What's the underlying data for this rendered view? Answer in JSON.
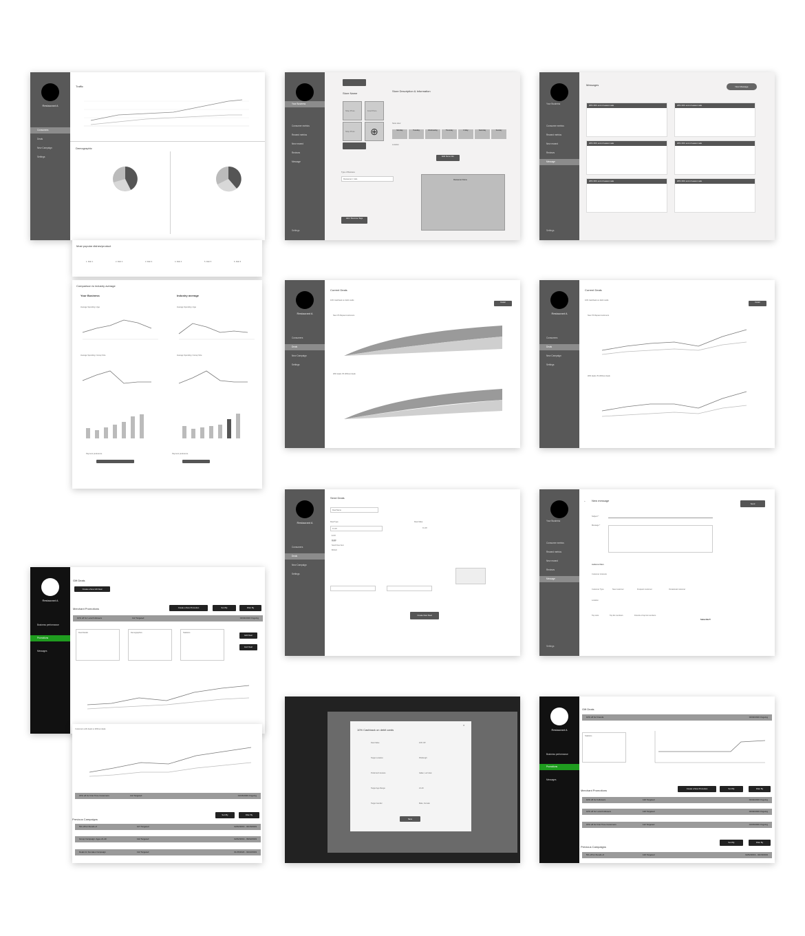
{
  "restaurant": "Restaurant A",
  "nav": {
    "your_business": "Your Business",
    "consumer_metrics": "Consumer metrics",
    "reward_metrics": "Reward metrics",
    "new_reward": "New reward",
    "reviews": "Reviews",
    "message": "Message",
    "settings": "Settings",
    "business_performance": "Business performance",
    "promotions": "Promotions",
    "messages": "Messages",
    "consumers": "Consumers",
    "deals": "Deals",
    "new_campaign": "New Campaign"
  },
  "dash": {
    "traffic": "Traffic",
    "demographic": "Demographic",
    "most_popular": "Most popular dishes/product",
    "comparison": "Comparison to industry average",
    "your_business": "Your Business",
    "industry_average": "Industry average",
    "dishes": [
      "1. Dish 1",
      "2. Dish 2",
      "3. Dish 3",
      "4. Dish 4",
      "5. Dish 5",
      "6. Dish 6"
    ],
    "payment": "Payment preference",
    "avg_spending_age": "Average Spending / Age",
    "avg_spending_group": "Average Spending / Group Size"
  },
  "store": {
    "store_name": "Store Name",
    "desc": "Store Description & Information",
    "shop_photo": "Shop Photo",
    "food_photo": "Food Photo",
    "store_hour": "Store Hour",
    "location": "Location",
    "days": [
      "Monday",
      "Tuesday",
      "Wednesday",
      "Thursday",
      "Friday",
      "Saturday",
      "Sunday"
    ],
    "edit_store_info": "Edit Store Info",
    "restaurant_menu": "Restaurant Menu",
    "add_remove_tags": "Add / Remove Tags",
    "type": "Type of Business",
    "options": [
      "Restaurant / Cafe",
      "Retail"
    ]
  },
  "messages": {
    "title": "Messages",
    "new_message": "New Message",
    "card_title_a": "20% OFF end of season sale",
    "card_title_b": "20% OFF end of season sale",
    "date": "4/15/2020"
  },
  "deals": {
    "current_deals": "Current Deals",
    "deal_name": "10% Cashback on debit cards",
    "new_vs_repeat": "New VS Repeat customers",
    "with_vs_without": "With deals VS Without deals",
    "detail": "Detail",
    "legend_new": "New customers",
    "legend_repeat": "Repeat customers",
    "legend_with": "With the deal",
    "legend_without": "Without deal"
  },
  "send": {
    "title": "Send Deals",
    "deal_name": "Deal Name",
    "deal_type": "Deal Type",
    "deal_value": "Deal Value",
    "percent_off": "% Off",
    "options": [
      "$ Off",
      "% Off",
      "Send Free Item",
      "BOGO"
    ],
    "create": "Create New Deal"
  },
  "newmsg": {
    "title": "New message",
    "send": "Send",
    "subject": "Subject *",
    "message": "Message *",
    "audience": "Audience filters",
    "interests": "Customer interests",
    "customer_type": "Customer Type",
    "new_customer": "New customer",
    "frequent": "Frequent customer",
    "occasional": "Occasional customer",
    "location": "Location",
    "top_lists": "Top Lists",
    "top_members": "Top list members",
    "friends": "Friends of top list members",
    "subscribe": "Subscribe?!"
  },
  "promo": {
    "gift_deals": "Gift Deals",
    "create_gift": "Create a New Gift Deal",
    "merchant": "Merchant Promotions",
    "create_promo": "Create a New Promotion",
    "sort_by": "Sort By",
    "filter_by": "Filter By",
    "row1": "10% off for Local Followers",
    "row1_target": "112 Targeted",
    "row1_date": "02/02/2020 Ongoing",
    "deal_details": "Deal Details",
    "demographics": "Demographics",
    "statistics": "Statistics",
    "edit_deal": "Edit Deal",
    "end_deal": "End Deal",
    "customers_with": "Customers with deals vs Without deals",
    "row2": "15% off for First Time Customers",
    "row2_target": "112 Targeted",
    "row2_date": "01/15/2020 Ongoing",
    "previous": "Previous Campaigns",
    "prev1": "5% off for friends of",
    "prev1_target": "107 Targeted",
    "prev1_date": "02/02/2019 - 04/15/2019",
    "prev2": "Group Campaign: Ages 21-40",
    "prev2_target": "112 Targeted",
    "prev2_date": "02/02/2019 - 09/02/2019",
    "prev3": "Deals for Females Campaign",
    "prev3_target": "112 Targeted",
    "prev3_date": "01/15/2020 - 02/22/2019"
  },
  "modal": {
    "title": "10% Cashback on debit cards",
    "deal_value": "Deal Value",
    "deal_value_v": "10% Off",
    "target_location": "Target Location",
    "target_location_v": "Pittsburgh",
    "preferred": "Preferred Interests",
    "preferred_v": "Italian, Let's Eat",
    "age": "Target Age Range",
    "age_v": "21-40",
    "gender": "Target Gender",
    "gender_v": "Male, Female",
    "save": "Save"
  },
  "promo2": {
    "gift_deals": "Gift Deals",
    "row": "10% off for Friends",
    "row_date": "02/02/2020 Ongoing",
    "statistics": "Statistics",
    "merchant": "Merchant Promotions",
    "create_promo": "Create a New Promotion",
    "sort_by": "Sort By",
    "filter_by": "Filter By",
    "r1": "10% off for Followers",
    "r1_t": "120 Targeted",
    "r1_d": "02/02/2020 Ongoing",
    "r2": "10% off for Local Followers",
    "r2_t": "120 Targeted",
    "r2_d": "02/02/2020 Ongoing",
    "r3": "15% off for First Time Customers",
    "r3_t": "112 Targeted",
    "r3_d": "01/15/2020 Ongoing",
    "previous": "Previous Campaigns",
    "p1": "5% off for friends of",
    "p1_t": "120 Targeted",
    "p1_d": "02/02/2019 - 04/15/2019"
  }
}
